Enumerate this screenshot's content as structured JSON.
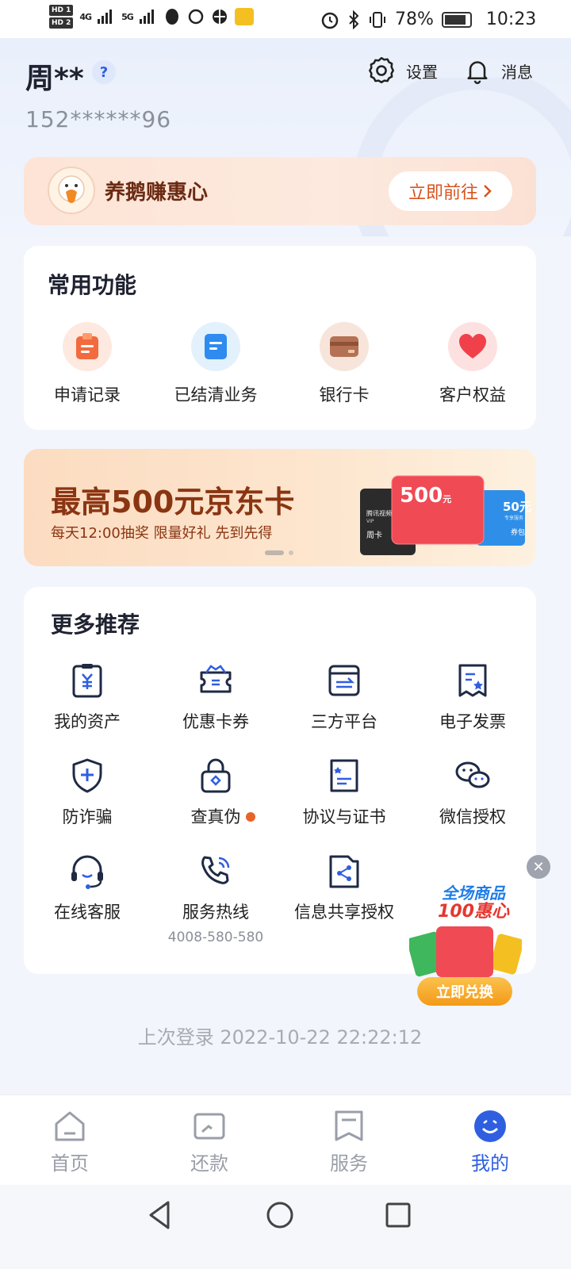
{
  "status_bar": {
    "sim1": "HD 1",
    "sim2": "HD 2",
    "net1": "4G",
    "net2": "5G",
    "battery": "78%",
    "time": "10:23"
  },
  "header": {
    "username": "周**",
    "help": "?",
    "phone": "152******96",
    "settings_label": "设置",
    "messages_label": "消息"
  },
  "goose_card": {
    "title": "养鹅赚惠心",
    "cta": "立即前往"
  },
  "common_functions": {
    "title": "常用功能",
    "items": [
      {
        "label": "申请记录",
        "icon": "clipboard-icon"
      },
      {
        "label": "已结清业务",
        "icon": "document-icon"
      },
      {
        "label": "银行卡",
        "icon": "bank-card-icon"
      },
      {
        "label": "客户权益",
        "icon": "heart-icon"
      }
    ]
  },
  "banner": {
    "title": "最高500元京东卡",
    "subtitle": "每天12:00抽奖 限量好礼 先到先得",
    "card_value": "500",
    "card_unit": "元",
    "small_card_value": "50元",
    "card_week": "周卡",
    "card_brand": "腾讯视频",
    "card_vip": "VIP",
    "card_extra": "专享服务",
    "card_pack": "券包"
  },
  "more_recommend": {
    "title": "更多推荐",
    "items": [
      {
        "label": "我的资产",
        "icon": "assets-icon"
      },
      {
        "label": "优惠卡券",
        "icon": "coupon-icon"
      },
      {
        "label": "三方平台",
        "icon": "third-party-icon"
      },
      {
        "label": "电子发票",
        "icon": "invoice-icon"
      },
      {
        "label": "防诈骗",
        "icon": "shield-plus-icon"
      },
      {
        "label": "查真伪",
        "icon": "lock-verify-icon"
      },
      {
        "label": "协议与证书",
        "icon": "agreement-icon"
      },
      {
        "label": "微信授权",
        "icon": "wechat-icon"
      },
      {
        "label": "在线客服",
        "icon": "headset-icon"
      },
      {
        "label": "服务热线",
        "icon": "phone-icon",
        "sub": "4008-580-580"
      },
      {
        "label": "信息共享授权",
        "icon": "share-icon"
      }
    ]
  },
  "promo_float": {
    "line1": "全场商品",
    "line2": "100惠心",
    "cta": "立即兑换"
  },
  "last_login": "上次登录 2022-10-22 22:22:12",
  "tabbar": {
    "tabs": [
      {
        "label": "首页",
        "icon": "home-icon"
      },
      {
        "label": "还款",
        "icon": "repay-icon"
      },
      {
        "label": "服务",
        "icon": "bookmark-icon"
      },
      {
        "label": "我的",
        "icon": "profile-icon",
        "active": true
      }
    ]
  },
  "colors": {
    "accent": "#2f5fe0",
    "brand_orange": "#d9531e",
    "banner_text": "#8a3512"
  }
}
